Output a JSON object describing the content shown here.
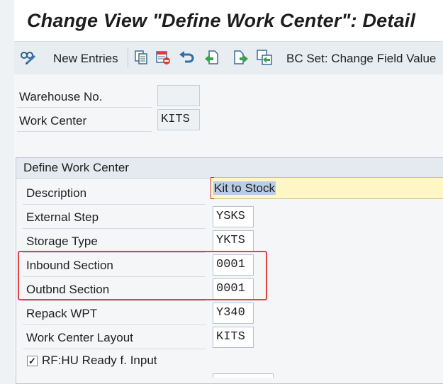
{
  "title": "Change View \"Define Work Center\": Detail",
  "toolbar": {
    "new_entries_label": "New Entries",
    "bc_set_label": "BC Set: Change Field Value"
  },
  "header": {
    "warehouse_label": "Warehouse No.",
    "warehouse_value": "",
    "work_center_label": "Work Center",
    "work_center_value": "KITS"
  },
  "group": {
    "title": "Define Work Center",
    "rows": [
      {
        "label": "Description",
        "value": "Kit to Stock"
      },
      {
        "label": "External Step",
        "value": "YSKS"
      },
      {
        "label": "Storage Type",
        "value": "YKTS"
      },
      {
        "label": "Inbound Section",
        "value": "0001"
      },
      {
        "label": "Outbnd Section",
        "value": "0001"
      },
      {
        "label": "Repack WPT",
        "value": "Y340"
      },
      {
        "label": "Work Center Layout",
        "value": "KITS"
      }
    ],
    "checkbox_label": "RF:HU Ready f. Input",
    "checkbox_checked": "✓"
  },
  "colors": {
    "highlight_border": "#e0443c",
    "required_field_bg": "#fff6c5"
  },
  "icons": [
    "display-change-icon",
    "copy-icon",
    "delete-icon",
    "undo-icon",
    "transport-left-icon",
    "transport-right-icon",
    "bc-set-icon"
  ]
}
